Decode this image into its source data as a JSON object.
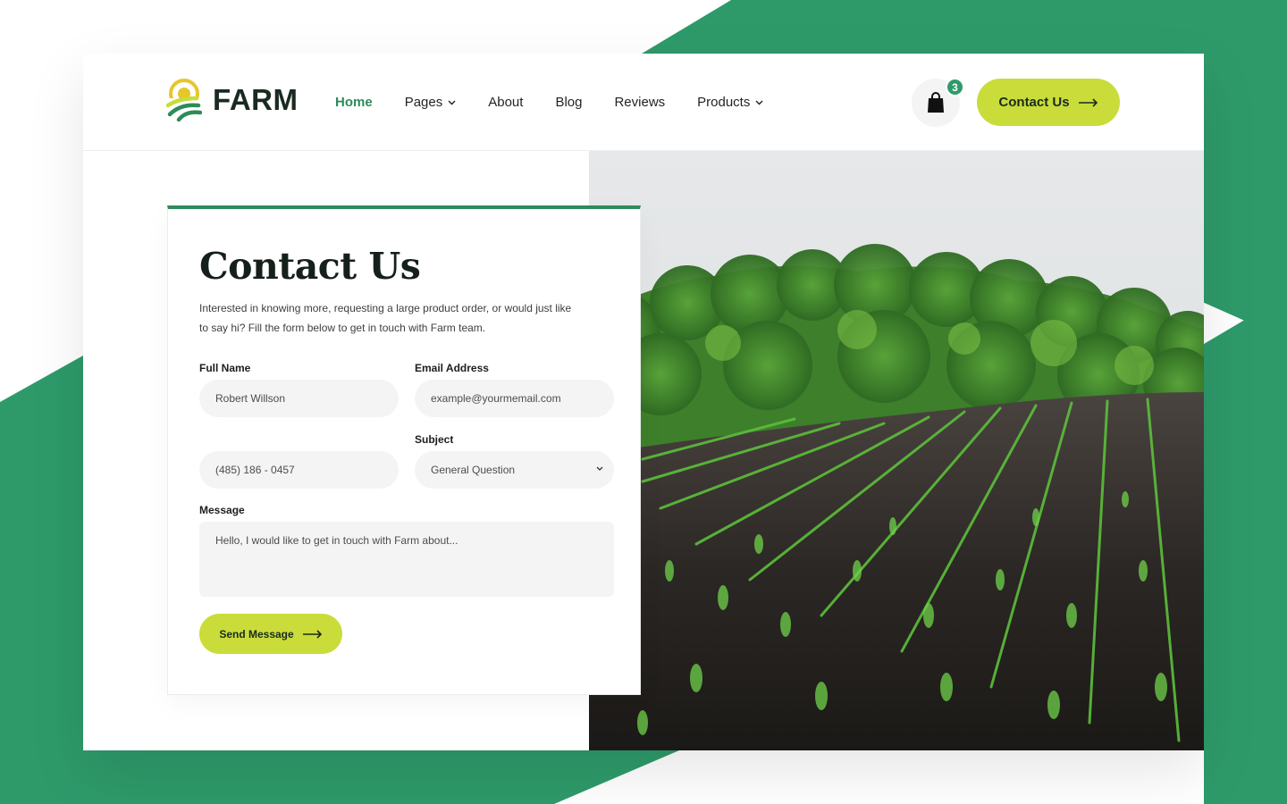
{
  "brand": {
    "name": "FARM",
    "primary_color": "#2e8b5a",
    "accent_color": "#c9dc3a",
    "logo_icon": "farm-sun-field-icon"
  },
  "nav": {
    "items": [
      {
        "label": "Home",
        "active": true,
        "has_dropdown": false
      },
      {
        "label": "Pages",
        "active": false,
        "has_dropdown": true
      },
      {
        "label": "About",
        "active": false,
        "has_dropdown": false
      },
      {
        "label": "Blog",
        "active": false,
        "has_dropdown": false
      },
      {
        "label": "Reviews",
        "active": false,
        "has_dropdown": false
      },
      {
        "label": "Products",
        "active": false,
        "has_dropdown": true
      }
    ]
  },
  "header": {
    "cart_icon": "shopping-bag-icon",
    "cart_count": "3",
    "cta_label": "Contact Us",
    "cta_icon": "arrow-right-icon"
  },
  "form": {
    "title": "Contact Us",
    "description": "Interested in knowing more, requesting a large product order, or would just like to say hi? Fill the form below to get in touch with Farm team.",
    "full_name": {
      "label": "Full Name",
      "value": "Robert Willson"
    },
    "email": {
      "label": "Email Address",
      "placeholder": "example@yourmemail.com"
    },
    "phone": {
      "value": "(485) 186 - 0457"
    },
    "subject": {
      "label": "Subject",
      "selected": "General Question"
    },
    "message": {
      "label": "Message",
      "placeholder": "Hello, I would like to get in touch with Farm about..."
    },
    "submit_label": "Send Message"
  },
  "hero_image": {
    "subject": "field-with-young-corn-rows-and-forest"
  }
}
